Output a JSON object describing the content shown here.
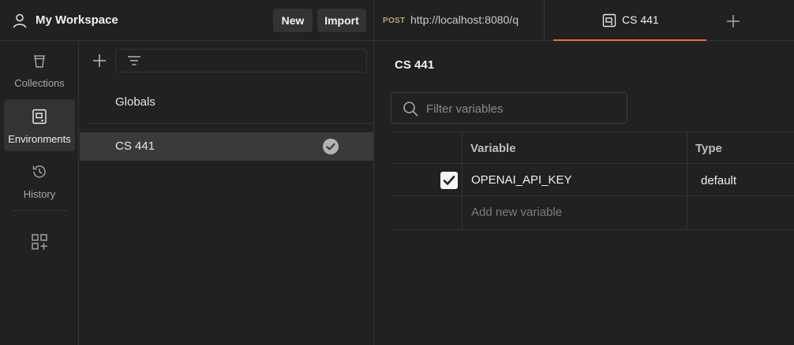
{
  "header": {
    "workspace_title": "My Workspace",
    "new_label": "New",
    "import_label": "Import"
  },
  "tabs": {
    "request": {
      "method": "POST",
      "url": "http://localhost:8080/q"
    },
    "environment": {
      "label": "CS 441"
    }
  },
  "sidebar": {
    "items": [
      {
        "label": "Collections",
        "icon": "trash-bucket-icon"
      },
      {
        "label": "Environments",
        "icon": "environment-icon",
        "active": true
      },
      {
        "label": "History",
        "icon": "history-icon"
      }
    ]
  },
  "env_list": {
    "items": [
      {
        "label": "Globals"
      },
      {
        "label": "CS 441",
        "active": true
      }
    ]
  },
  "main": {
    "title": "CS 441",
    "filter_placeholder": "Filter variables",
    "columns": {
      "variable": "Variable",
      "type": "Type"
    },
    "rows": [
      {
        "checked": true,
        "variable": "OPENAI_API_KEY",
        "type": "default"
      }
    ],
    "add_placeholder": "Add new variable"
  },
  "colors": {
    "accent": "#f26b3a",
    "background": "#212121",
    "selected": "#3a3a3a",
    "method_post": "#b8a36a"
  }
}
